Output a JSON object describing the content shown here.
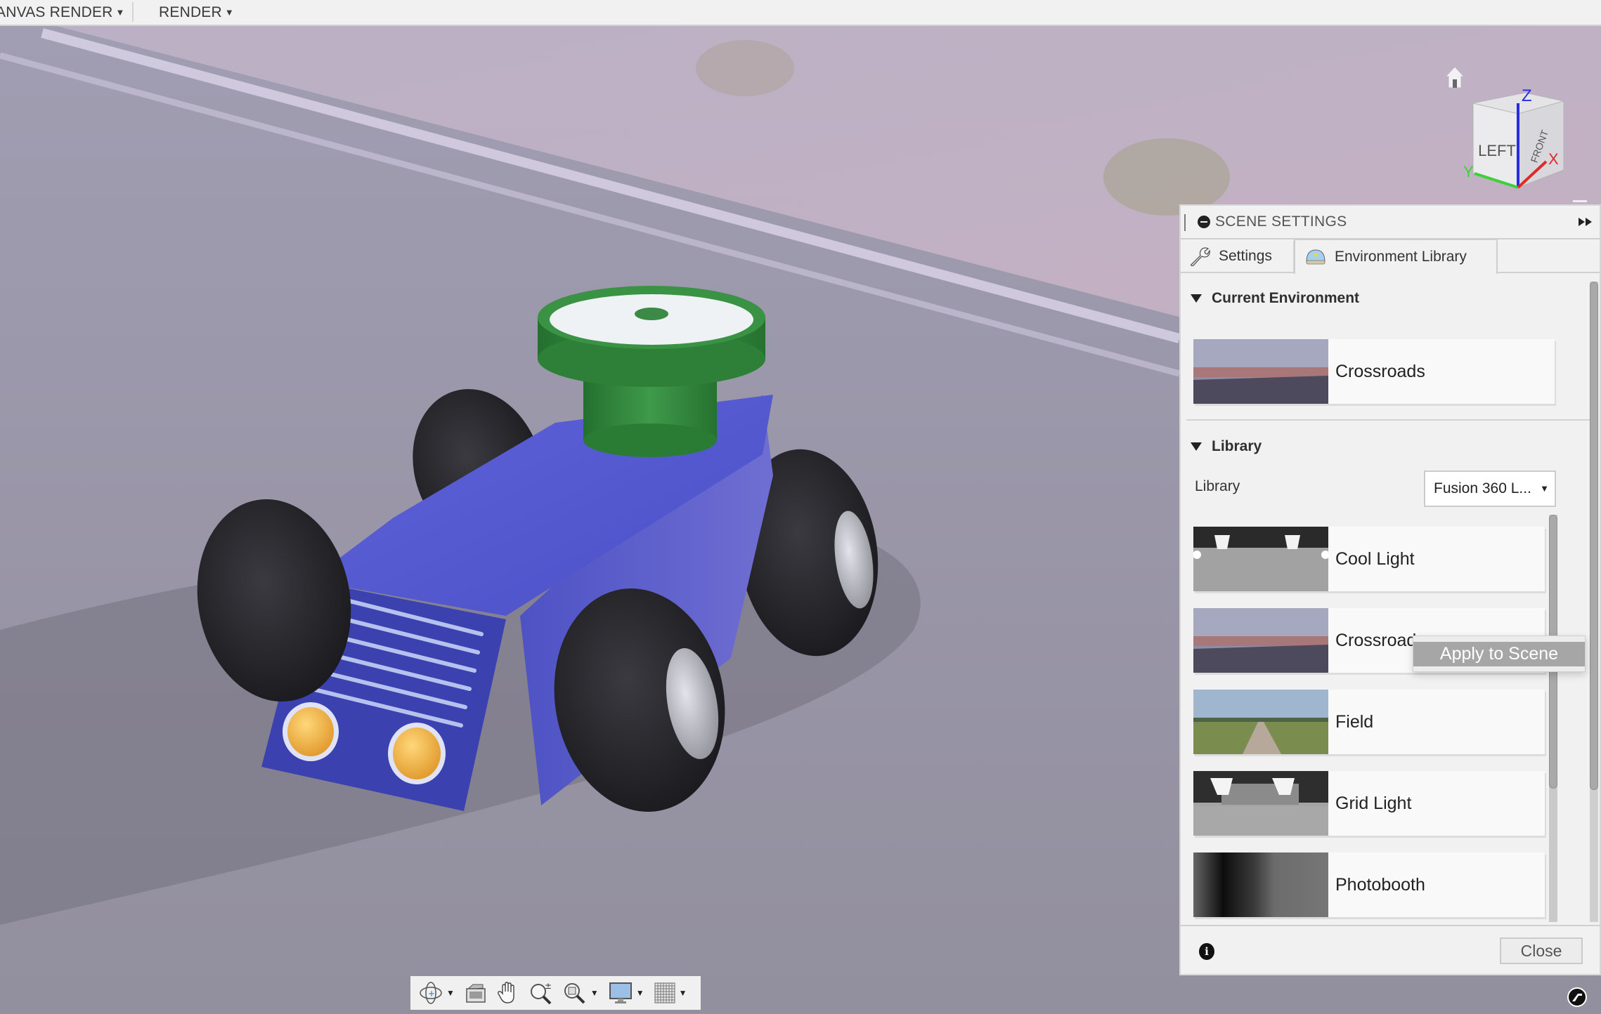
{
  "toolbar": {
    "menus": [
      {
        "label": "ANVAS RENDER"
      },
      {
        "label": "RENDER"
      }
    ]
  },
  "viewport": {
    "viewcube": {
      "face_left": "LEFT",
      "face_front": "FRONT",
      "axis_x": "X",
      "axis_y": "Y",
      "axis_z": "Z"
    },
    "nav_tools": [
      "orbit",
      "look-at",
      "pan",
      "zoom",
      "zoom-window",
      "display-settings",
      "grid-settings"
    ]
  },
  "panel": {
    "title": "SCENE SETTINGS",
    "tabs": [
      {
        "label": "Settings",
        "icon": "wrench-icon",
        "active": false
      },
      {
        "label": "Environment Library",
        "icon": "environment-dome-icon",
        "active": true
      }
    ],
    "current_environment": {
      "heading": "Current Environment",
      "name": "Crossroads"
    },
    "library": {
      "heading": "Library",
      "field_label": "Library",
      "selected": "Fusion 360 L...",
      "items": [
        {
          "name": "Cool Light"
        },
        {
          "name": "Crossroads"
        },
        {
          "name": "Field"
        },
        {
          "name": "Grid Light"
        },
        {
          "name": "Photobooth"
        }
      ]
    },
    "footer": {
      "close_label": "Close"
    }
  },
  "context_menu": {
    "items": [
      {
        "label": "Apply to Scene"
      }
    ]
  },
  "colors": {
    "car_body": "#4b4fc9",
    "car_accent": "#2f8a3c",
    "headlight": "#f2b440",
    "tire": "#26262b",
    "panel_bg": "#f1f1f1",
    "context_highlight": "#a6a6a6"
  }
}
